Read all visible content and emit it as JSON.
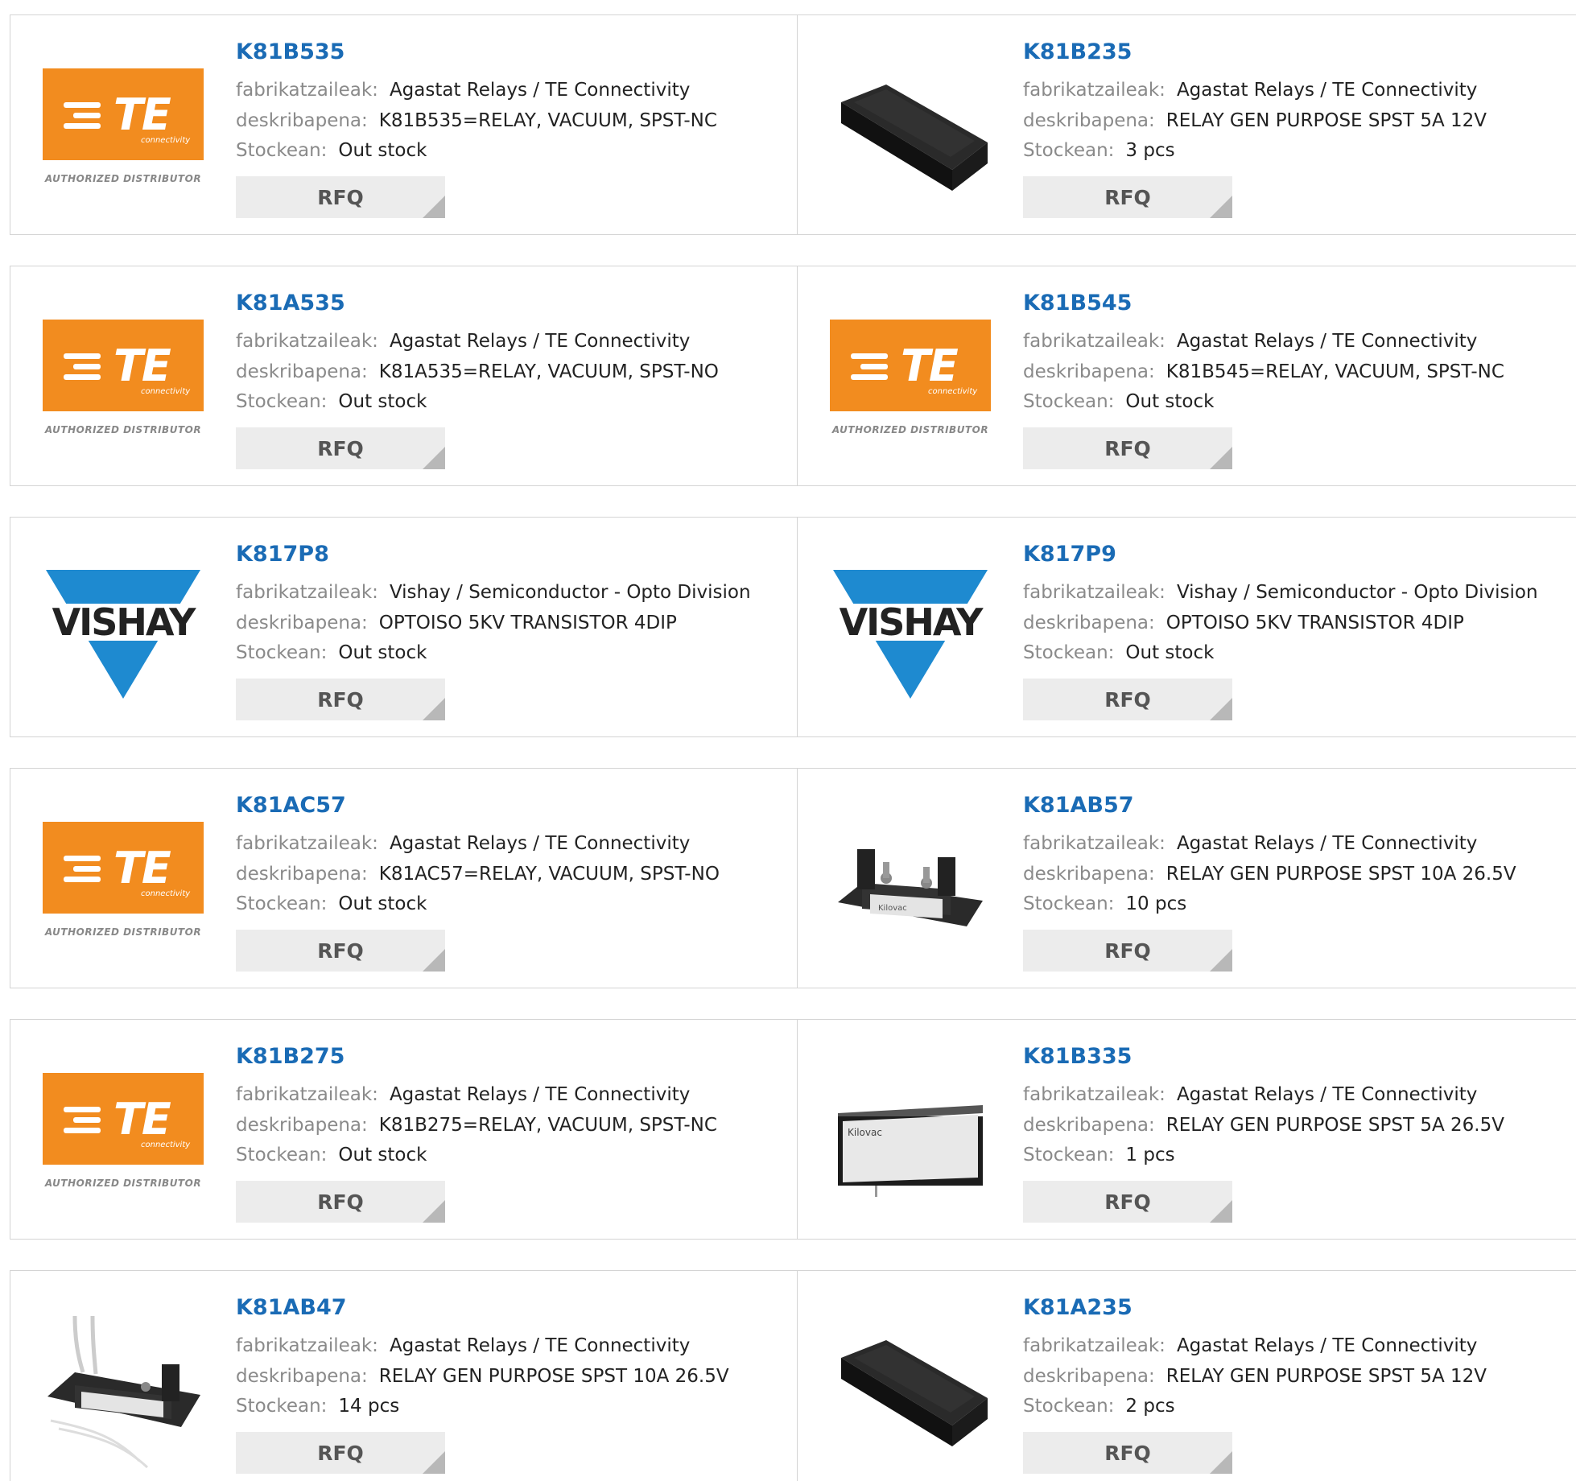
{
  "labels": {
    "manufacturer": "fabrikatzaileak:",
    "description": "deskribapena:",
    "stock": "Stockean:",
    "rfq": "RFQ"
  },
  "logos": {
    "te_word": "TE",
    "te_sub": "connectivity",
    "te_authorized": "AUTHORIZED DISTRIBUTOR",
    "vishay_word": "VISHAY"
  },
  "colors": {
    "link": "#1a6bb5",
    "te_orange": "#f28c1f",
    "vishay_blue": "#1e8ad0",
    "rfq_bg": "#ececec"
  },
  "products": [
    {
      "part": "K81B535",
      "image": "te-logo",
      "manufacturer": "Agastat Relays / TE Connectivity",
      "description": "K81B535=RELAY, VACUUM, SPST-NC",
      "stock": "Out stock"
    },
    {
      "part": "K81B235",
      "image": "relay-black-block",
      "manufacturer": "Agastat Relays / TE Connectivity",
      "description": "RELAY GEN PURPOSE SPST 5A 12V",
      "stock": "3 pcs"
    },
    {
      "part": "K81A535",
      "image": "te-logo",
      "manufacturer": "Agastat Relays / TE Connectivity",
      "description": "K81A535=RELAY, VACUUM, SPST-NO",
      "stock": "Out stock"
    },
    {
      "part": "K81B545",
      "image": "te-logo",
      "manufacturer": "Agastat Relays / TE Connectivity",
      "description": "K81B545=RELAY, VACUUM, SPST-NC",
      "stock": "Out stock"
    },
    {
      "part": "K817P8",
      "image": "vishay-logo",
      "manufacturer": "Vishay / Semiconductor - Opto Division",
      "description": "OPTOISO 5KV TRANSISTOR 4DIP",
      "stock": "Out stock"
    },
    {
      "part": "K817P9",
      "image": "vishay-logo",
      "manufacturer": "Vishay / Semiconductor - Opto Division",
      "description": "OPTOISO 5KV TRANSISTOR 4DIP",
      "stock": "Out stock"
    },
    {
      "part": "K81AC57",
      "image": "te-logo",
      "manufacturer": "Agastat Relays / TE Connectivity",
      "description": "K81AC57=RELAY, VACUUM, SPST-NO",
      "stock": "Out stock"
    },
    {
      "part": "K81AB57",
      "image": "relay-with-terminals",
      "manufacturer": "Agastat Relays / TE Connectivity",
      "description": "RELAY GEN PURPOSE SPST 10A 26.5V",
      "stock": "10 pcs"
    },
    {
      "part": "K81B275",
      "image": "te-logo",
      "manufacturer": "Agastat Relays / TE Connectivity",
      "description": "K81B275=RELAY, VACUUM, SPST-NC",
      "stock": "Out stock"
    },
    {
      "part": "K81B335",
      "image": "relay-kilovac",
      "manufacturer": "Agastat Relays / TE Connectivity",
      "description": "RELAY GEN PURPOSE SPST 5A 26.5V",
      "stock": "1 pcs"
    },
    {
      "part": "K81AB47",
      "image": "relay-with-wires",
      "manufacturer": "Agastat Relays / TE Connectivity",
      "description": "RELAY GEN PURPOSE SPST 10A 26.5V",
      "stock": "14 pcs"
    },
    {
      "part": "K81A235",
      "image": "relay-black-block",
      "manufacturer": "Agastat Relays / TE Connectivity",
      "description": "RELAY GEN PURPOSE SPST 5A 12V",
      "stock": "2 pcs"
    }
  ]
}
